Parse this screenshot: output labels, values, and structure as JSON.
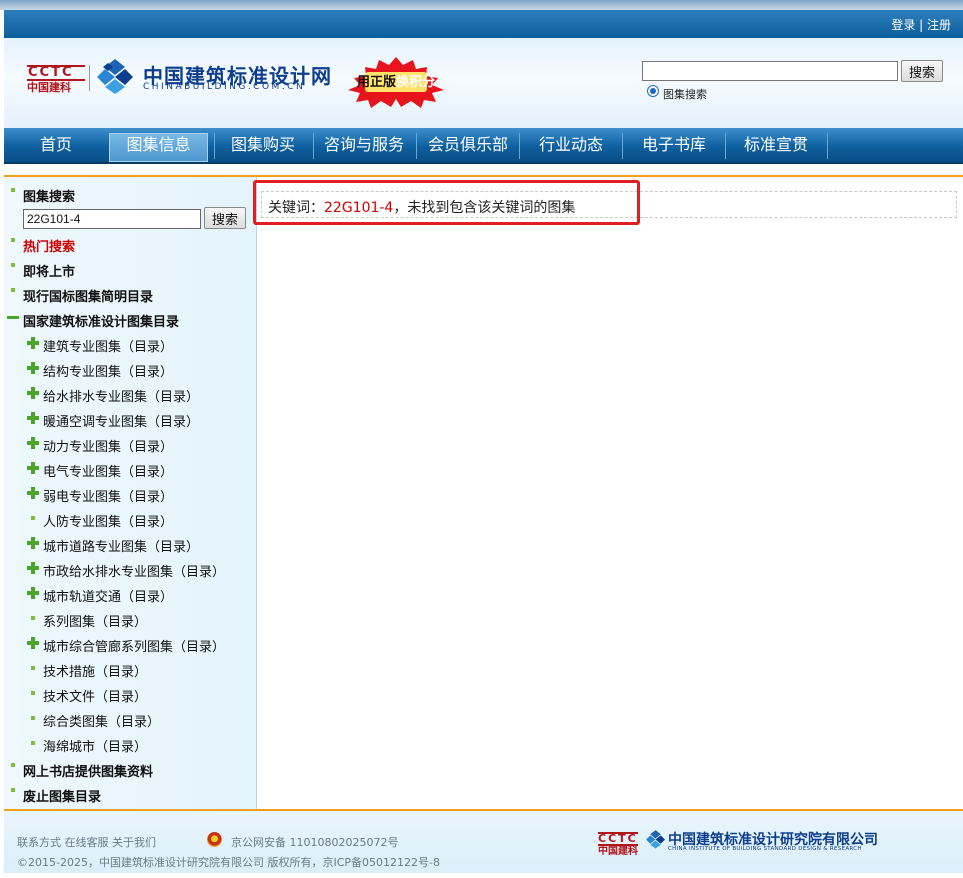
{
  "auth": {
    "text": "登录 | 注册"
  },
  "logo": {
    "cctc_top": "CCTC",
    "cctc_bottom": "中国建科",
    "cn_name": "中国建筑标准设计网",
    "en_name": "CHINABUILDING.COM.CN"
  },
  "promo": {
    "part1": "用正版",
    "part2": "换积分"
  },
  "search": {
    "value": "",
    "button": "搜索",
    "radio_label": "图集搜索"
  },
  "nav": {
    "items": [
      "首页",
      "图集信息",
      "图集购买",
      "咨询与服务",
      "会员俱乐部",
      "行业动态",
      "电子书库",
      "标准宣贯"
    ],
    "active": "图集信息"
  },
  "sidebar": {
    "search_title": "图集搜索",
    "search_value": "22G101-4",
    "search_button": "搜索",
    "hot_search": "热门搜索",
    "coming_soon": "即将上市",
    "current_catalog": "现行国标图集简明目录",
    "national_catalog": "国家建筑标准设计图集目录",
    "categories": [
      {
        "label": "建筑专业图集（目录）",
        "icon": "plus"
      },
      {
        "label": "结构专业图集（目录）",
        "icon": "plus"
      },
      {
        "label": "给水排水专业图集（目录）",
        "icon": "plus"
      },
      {
        "label": "暖通空调专业图集（目录）",
        "icon": "plus"
      },
      {
        "label": "动力专业图集（目录）",
        "icon": "plus"
      },
      {
        "label": "电气专业图集（目录）",
        "icon": "plus"
      },
      {
        "label": "弱电专业图集（目录）",
        "icon": "plus"
      },
      {
        "label": "人防专业图集（目录）",
        "icon": "bullet"
      },
      {
        "label": "城市道路专业图集（目录）",
        "icon": "plus"
      },
      {
        "label": "市政给水排水专业图集（目录）",
        "icon": "plus"
      },
      {
        "label": "城市轨道交通（目录）",
        "icon": "plus"
      },
      {
        "label": "系列图集（目录）",
        "icon": "bullet"
      },
      {
        "label": "城市综合管廊系列图集（目录）",
        "icon": "plus"
      },
      {
        "label": "技术措施（目录）",
        "icon": "bullet"
      },
      {
        "label": "技术文件（目录）",
        "icon": "bullet"
      },
      {
        "label": "综合类图集（目录）",
        "icon": "bullet"
      },
      {
        "label": "海绵城市（目录）",
        "icon": "bullet"
      }
    ],
    "online_store": "网上书店提供图集资料",
    "abolished": "废止图集目录"
  },
  "result": {
    "prefix": "关键词：",
    "keyword": "22G101-4",
    "suffix": "，未找到包含该关键词的图集"
  },
  "footer": {
    "links": "联系方式 在线客服 关于我们",
    "police": "京公网安备 11010802025072号",
    "copyright": "©2015-2025，中国建筑标准设计研究院有限公司  版权所有，京ICP备05012122号-8",
    "org_cctc": "CCTC",
    "org_cctc_cn": "中国建科",
    "org_cn": "中国建筑标准设计研究院有限公司",
    "org_en": "CHINA INSTITUTE OF BUILDING STANDARD DESIGN & RESEARCH"
  },
  "colors": {
    "nav_blue": "#0e5f9f",
    "accent_orange": "#f0a020",
    "keyword_red": "#d00000",
    "plus_green": "#4aa52a"
  }
}
